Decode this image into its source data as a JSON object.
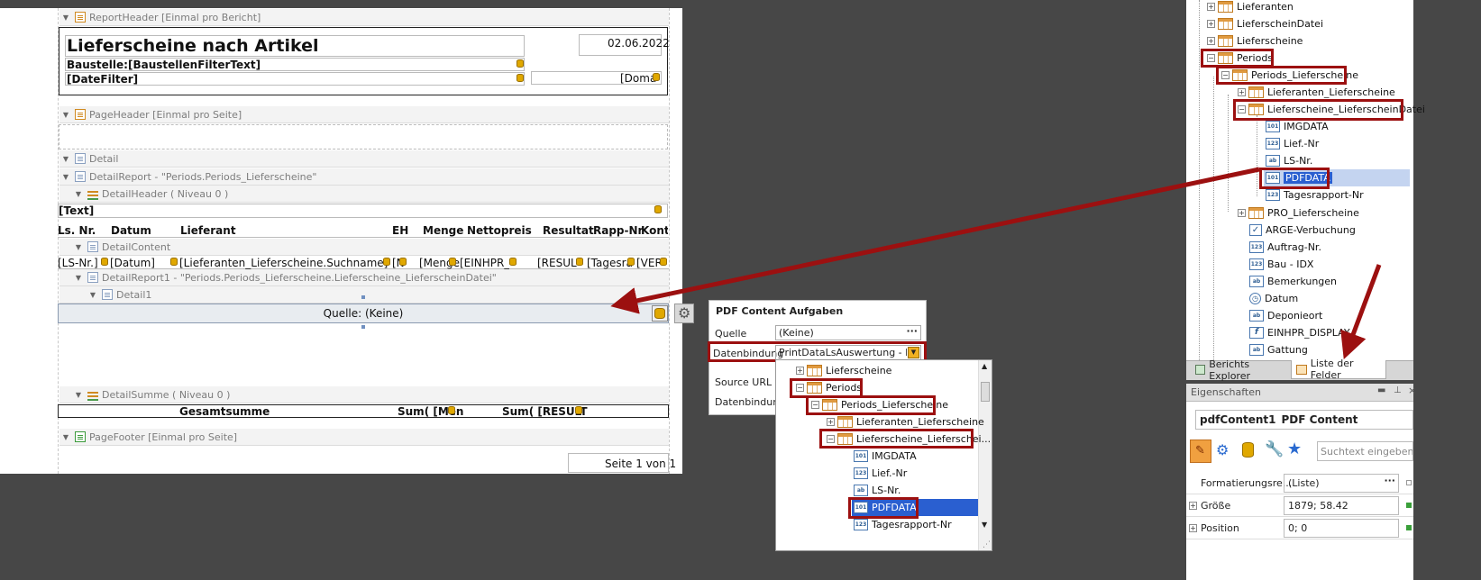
{
  "report": {
    "header_band": "ReportHeader [Einmal pro Bericht]",
    "title": "Lieferscheine nach Artikel",
    "date": "02.06.2022",
    "baustelle_label": "Baustelle:",
    "baustelle_value": "[BaustellenFilterText]",
    "date_filter": "[DateFilter]",
    "domain": "[Doma",
    "page_header_band": "PageHeader [Einmal pro Seite]",
    "detail_band": "Detail",
    "detail_report_band": "DetailReport - \"Periods.Periods_Lieferscheine\"",
    "detail_header_band": "DetailHeader ( Niveau 0 )",
    "text_field": "[Text]",
    "columns": [
      "Ls. Nr.",
      "Datum",
      "Lieferant",
      "EH",
      "Menge",
      "Nettopreis",
      "Resultat",
      "Rapp-Nr",
      "Kontr"
    ],
    "detail_content_band": "DetailContent",
    "row_fields": [
      "[LS-Nr.]",
      "[Datum]",
      "[Lieferanten_Lieferscheine.Suchname]",
      "[N",
      "[Menge",
      "[EINHPR_",
      "[RESUL",
      "[Tagesra",
      "[VER"
    ],
    "detail_report1_band": "DetailReport1 - \"Periods.Periods_Lieferscheine.Lieferscheine_LieferscheinDatei\"",
    "detail1_band": "Detail1",
    "pdf_content": "Quelle: (Keine)",
    "detail_summe_band": "DetailSumme ( Niveau 0 )",
    "gesamtsumme": "Gesamtsumme",
    "sum_menge": "Sum( [Men",
    "sum_result": "Sum( [RESULT",
    "page_footer_band": "PageFooter [Einmal pro Seite]",
    "page_number": "Seite 1 von 1"
  },
  "popup": {
    "title": "PDF Content Aufgaben",
    "quelle_label": "Quelle",
    "quelle_value": "(Keine)",
    "datenbindung_label": "Datenbindung",
    "datenbindung_value": "PrintDataLsAuswertung - Perio",
    "source_url_label": "Source URL",
    "datenbindung2_label": "Datenbindung",
    "tree": [
      "Lieferscheine",
      "Periods",
      "Periods_Lieferscheine",
      "Lieferanten_Lieferscheine",
      "Lieferscheine_Lieferschei...",
      "IMGDATA",
      "Lief.-Nr",
      "LS-Nr.",
      "PDFDATA",
      "Tagesrapport-Nr"
    ]
  },
  "explorer": {
    "items": [
      "Lieferanten",
      "LieferscheinDatei",
      "Lieferscheine",
      "Periods",
      "Periods_Lieferscheine",
      "Lieferanten_Lieferscheine",
      "Lieferscheine_LieferscheinDatei",
      "IMGDATA",
      "Lief.-Nr",
      "LS-Nr.",
      "PDFDATA",
      "Tagesrapport-Nr",
      "PRO_Lieferscheine",
      "ARGE-Verbuchung",
      "Auftrag-Nr.",
      "Bau - IDX",
      "Bemerkungen",
      "Datum",
      "Deponieort",
      "EINHPR_DISPLAY",
      "Gattung"
    ],
    "tab_berichts": "Berichts Explorer",
    "tab_liste": "Liste der Felder"
  },
  "properties": {
    "title": "Eigenschaften",
    "object_name": "pdfContent1",
    "object_type": "PDF Content",
    "search_placeholder": "Suchtext eingeben",
    "rows": [
      {
        "label": "Formatierungsre...",
        "value": "(Liste)"
      },
      {
        "label": "Größe",
        "value": "1879; 58.42"
      },
      {
        "label": "Position",
        "value": "0; 0"
      }
    ]
  }
}
